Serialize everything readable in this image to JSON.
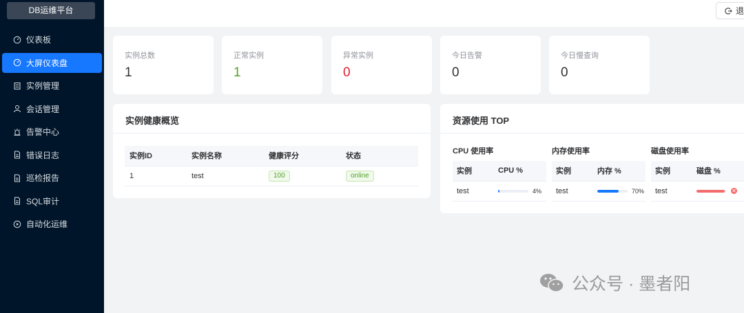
{
  "brand": "DB运维平台",
  "nav": [
    {
      "label": "仪表板",
      "icon": "dashboard-icon"
    },
    {
      "label": "大屏仪表盘",
      "icon": "dashboard-icon",
      "active": true
    },
    {
      "label": "实例管理",
      "icon": "list-icon"
    },
    {
      "label": "会话管理",
      "icon": "user-icon"
    },
    {
      "label": "告警中心",
      "icon": "alarm-icon"
    },
    {
      "label": "错误日志",
      "icon": "document-icon"
    },
    {
      "label": "巡检报告",
      "icon": "document-icon"
    },
    {
      "label": "SQL审计",
      "icon": "document-icon"
    },
    {
      "label": "自动化运维",
      "icon": "play-icon"
    }
  ],
  "topbar": {
    "logout_label": "退出",
    "logout_icon": "logout-icon"
  },
  "stats": [
    {
      "label": "实例总数",
      "value": "1"
    },
    {
      "label": "正常实例",
      "value": "1"
    },
    {
      "label": "异常实例",
      "value": "0"
    },
    {
      "label": "今日告警",
      "value": "0"
    },
    {
      "label": "今日慢查询",
      "value": "0"
    }
  ],
  "health": {
    "title": "实例健康概览",
    "columns": [
      "实例ID",
      "实例名称",
      "健康评分",
      "状态"
    ],
    "rows": [
      {
        "id": "1",
        "name": "test",
        "score": "100",
        "status": "online"
      }
    ]
  },
  "resource": {
    "title": "资源使用 TOP",
    "cpu": {
      "title": "CPU 使用率",
      "col_instance": "实例",
      "col_metric": "CPU %",
      "instance": "test",
      "percent": 4,
      "percent_text": "4%"
    },
    "mem": {
      "title": "内存使用率",
      "col_instance": "实例",
      "col_metric": "内存 %",
      "instance": "test",
      "percent": 70,
      "percent_text": "70%"
    },
    "disk": {
      "title": "磁盘使用率",
      "col_instance": "实例",
      "col_metric": "磁盘 %",
      "instance": "test",
      "percent": 93
    }
  },
  "colors": {
    "accent": "#1677ff",
    "sidebar": "#001529",
    "success": "#52a12a",
    "danger": "#e0202e",
    "disk_bar": "#f56c6c"
  },
  "watermark": "公众号 · 墨者阳"
}
